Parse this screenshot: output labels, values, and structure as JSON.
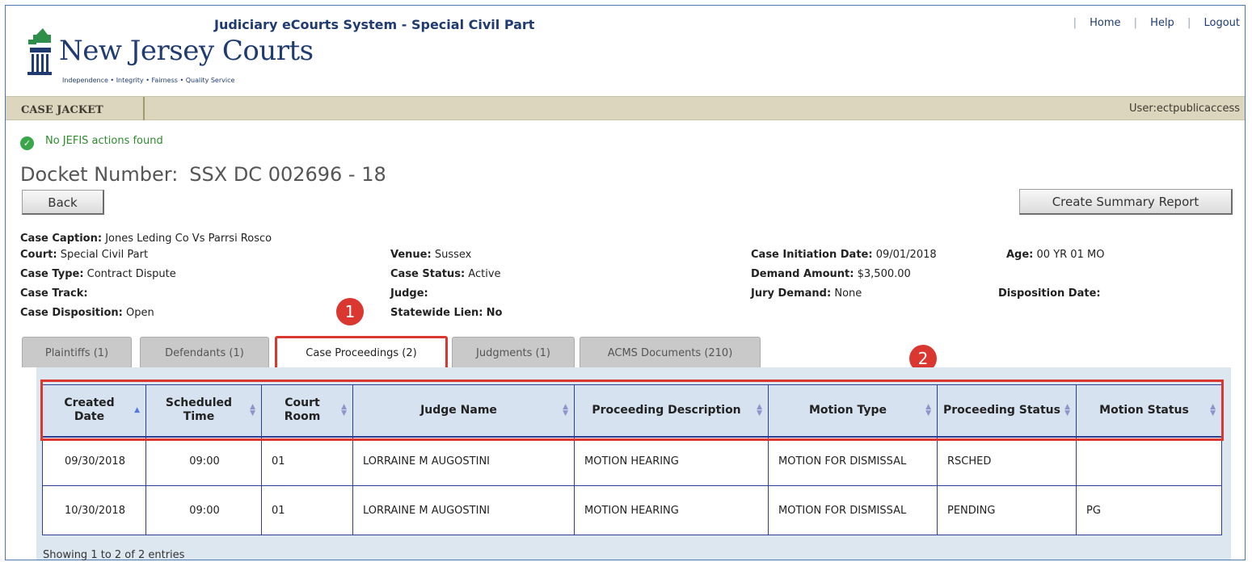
{
  "header": {
    "system_title": "Judiciary eCourts System - Special Civil Part",
    "links": [
      "Home",
      "Help",
      "Logout"
    ],
    "logo_title": "New Jersey Courts",
    "logo_tagline": "Independence • Integrity • Fairness • Quality Service"
  },
  "nav": {
    "case_jacket": "CASE JACKET",
    "user": "User:ectpublicaccess"
  },
  "notice": "No JEFIS actions found",
  "docket": {
    "label": "Docket Number:",
    "value": "SSX DC 002696 - 18"
  },
  "buttons": {
    "back": "Back",
    "summary": "Create Summary Report"
  },
  "case_info": {
    "caption_label": "Case Caption:",
    "caption": "Jones Leding Co Vs Parrsi Rosco",
    "court_label": "Court:",
    "court": "Special Civil Part",
    "type_label": "Case Type:",
    "type": "Contract Dispute",
    "track_label": "Case Track:",
    "track": "",
    "disposition_label": "Case Disposition:",
    "disposition": "Open",
    "venue_label": "Venue:",
    "venue": "Sussex",
    "status_label": "Case Status:",
    "status": "Active",
    "judge_label": "Judge:",
    "judge": "",
    "lien_label": "Statewide Lien:",
    "lien": "No",
    "initiation_label": "Case Initiation Date:",
    "initiation": "09/01/2018",
    "demand_label": "Demand Amount:",
    "demand": "$3,500.00",
    "jury_label": "Jury Demand:",
    "jury": "None",
    "age_label": "Age:",
    "age": "00 YR 01 MO",
    "disp_date_label": "Disposition Date:",
    "disp_date": ""
  },
  "annotations": [
    "1",
    "2"
  ],
  "tabs": [
    {
      "label": "Plaintiffs (1)"
    },
    {
      "label": "Defendants (1)"
    },
    {
      "label": "Case Proceedings (2)"
    },
    {
      "label": "Judgments (1)"
    },
    {
      "label": "ACMS Documents (210)"
    }
  ],
  "table": {
    "columns": [
      "Created Date",
      "Scheduled Time",
      "Court Room",
      "Judge Name",
      "Proceeding Description",
      "Motion Type",
      "Proceeding Status",
      "Motion Status"
    ],
    "rows": [
      [
        "09/30/2018",
        "09:00",
        "01",
        "LORRAINE M AUGOSTINI",
        "MOTION HEARING",
        "MOTION FOR DISMISSAL",
        "RSCHED",
        ""
      ],
      [
        "10/30/2018",
        "09:00",
        "01",
        "LORRAINE M AUGOSTINI",
        "MOTION HEARING",
        "MOTION FOR DISMISSAL",
        "PENDING",
        "PG"
      ]
    ],
    "info": "Showing 1 to 2 of 2 entries"
  },
  "colors": {
    "navy": "#1f3b70",
    "nav_bar": "#ddd6bf",
    "highlight": "#d9372f",
    "table_header": "#d6e2ef",
    "success": "#3aa64a"
  }
}
